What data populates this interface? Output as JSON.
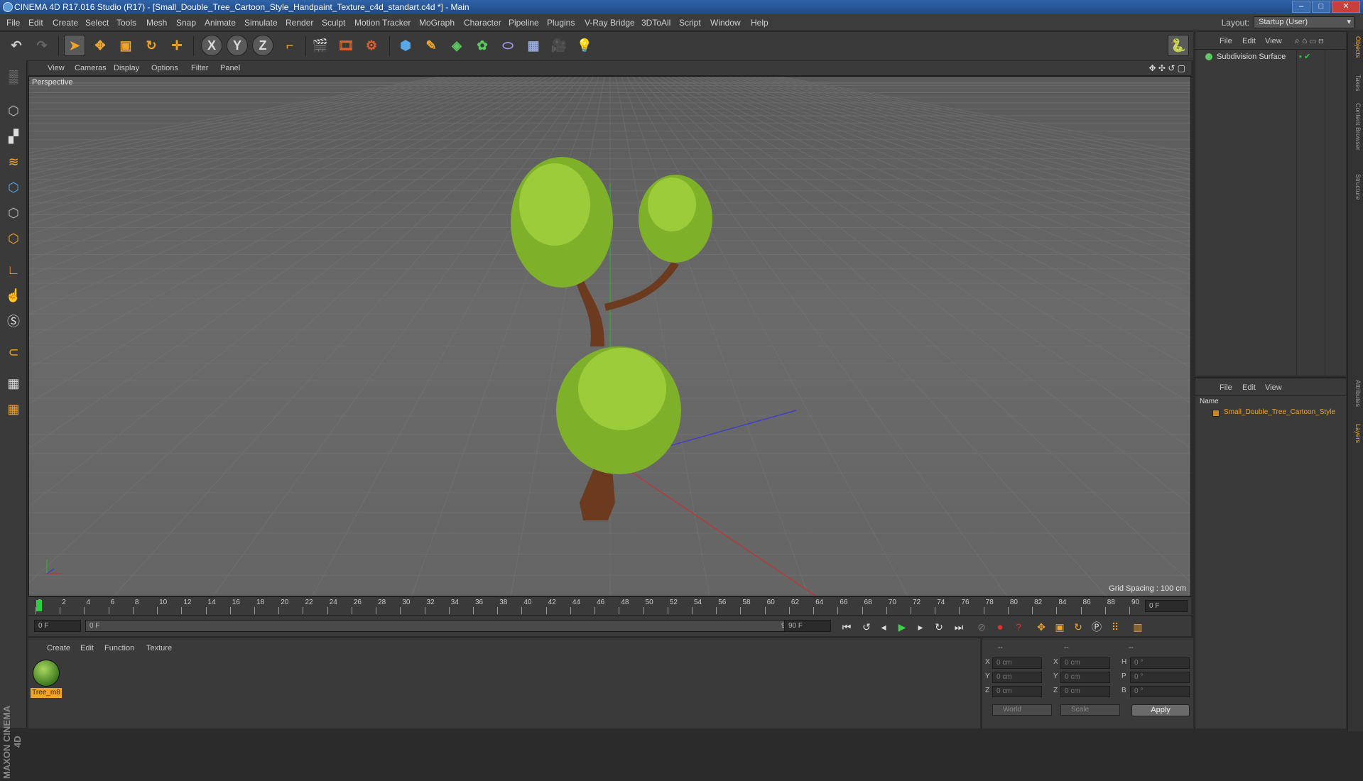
{
  "window": {
    "title": "CINEMA 4D R17.016 Studio (R17) - [Small_Double_Tree_Cartoon_Style_Handpaint_Texture_c4d_standart.c4d *] - Main",
    "buttons": [
      "–",
      "□",
      "✕"
    ]
  },
  "menubar": {
    "items": [
      "File",
      "Edit",
      "Create",
      "Select",
      "Tools",
      "Mesh",
      "Snap",
      "Animate",
      "Simulate",
      "Render",
      "Sculpt",
      "Motion Tracker",
      "MoGraph",
      "Character",
      "Pipeline",
      "Plugins",
      "V-Ray Bridge",
      "3DToAll",
      "Script",
      "Window",
      "Help"
    ],
    "layout_label": "Layout:",
    "layout_value": "Startup (User)"
  },
  "toolbar": {
    "axis_x": "X",
    "axis_y": "Y",
    "axis_z": "Z"
  },
  "viewport": {
    "menu": [
      "View",
      "Cameras",
      "Display",
      "Options",
      "Filter",
      "Panel"
    ],
    "camera_label": "Perspective",
    "grid_spacing": "Grid Spacing : 100 cm"
  },
  "timeline": {
    "ticks": [
      "0",
      "2",
      "4",
      "6",
      "8",
      "10",
      "12",
      "14",
      "16",
      "18",
      "20",
      "22",
      "24",
      "26",
      "28",
      "30",
      "32",
      "34",
      "36",
      "38",
      "40",
      "42",
      "44",
      "46",
      "48",
      "50",
      "52",
      "54",
      "56",
      "58",
      "60",
      "62",
      "64",
      "66",
      "68",
      "70",
      "72",
      "74",
      "76",
      "78",
      "80",
      "82",
      "84",
      "86",
      "88",
      "90"
    ],
    "current_frame": "0 F",
    "start_field": "0 F",
    "range_start": "0 F",
    "range_end": "90 F",
    "end_field": "90 F"
  },
  "material_panel": {
    "menu": [
      "Create",
      "Edit",
      "Function",
      "Texture"
    ],
    "material_name": "Tree_m8"
  },
  "coordinates": {
    "headers": [
      "--",
      "--",
      "--"
    ],
    "pos_labels": [
      "X",
      "Y",
      "Z"
    ],
    "pos_values": [
      "0 cm",
      "0 cm",
      "0 cm"
    ],
    "size_labels": [
      "X",
      "Y",
      "Z"
    ],
    "size_values": [
      "0 cm",
      "0 cm",
      "0 cm"
    ],
    "rot_labels": [
      "H",
      "P",
      "B"
    ],
    "rot_values": [
      "0 °",
      "0 °",
      "0 °"
    ],
    "mode_world": "World",
    "mode_scale": "Scale",
    "apply": "Apply"
  },
  "objects_panel": {
    "menu": [
      "File",
      "Edit",
      "View"
    ],
    "object": "Subdivision Surface"
  },
  "layers_panel": {
    "menu": [
      "File",
      "Edit",
      "View"
    ],
    "column": "Name",
    "object": "Small_Double_Tree_Cartoon_Style"
  },
  "side_tabs": [
    "Objects",
    "Takes",
    "Content Browser",
    "Structure",
    "Attributes",
    "Layers"
  ],
  "branding": "MAXON CINEMA 4D",
  "colors": {
    "accent": "#f1a42a",
    "title_blue": "#2f63a8",
    "tree_green": "#8fc43a",
    "trunk": "#6b3a1f"
  }
}
